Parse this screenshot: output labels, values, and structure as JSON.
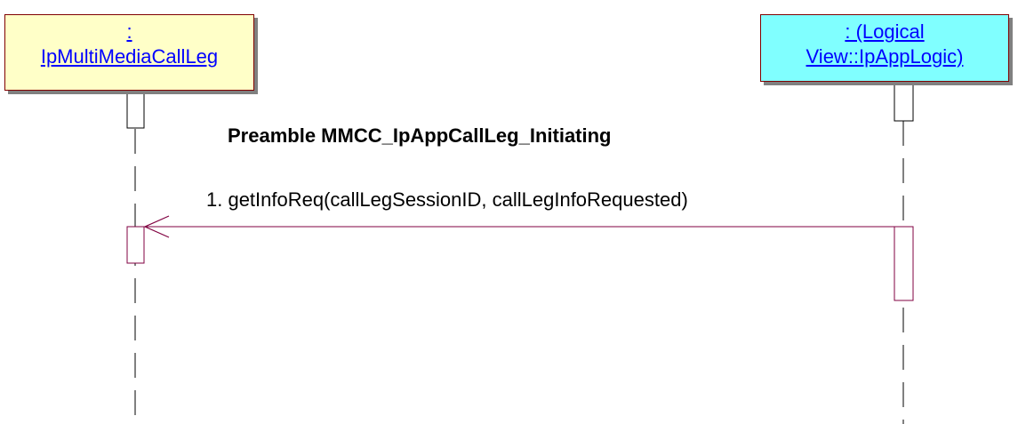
{
  "lifelines": [
    {
      "id": "left",
      "line1": ":",
      "line2": "IpMultiMediaCallLeg"
    },
    {
      "id": "right",
      "line1": ": (Logical",
      "line2": "View::IpAppLogic)"
    }
  ],
  "preamble": "Preamble MMCC_IpAppCallLeg_Initiating",
  "messages": [
    {
      "label": "1. getInfoReq(callLegSessionID, callLegInfoRequested)",
      "from": "right",
      "to": "left"
    }
  ],
  "colors": {
    "box_border": "#800000",
    "left_box_fill": "#ffffc8",
    "right_box_fill": "#80ffff",
    "lifeline_text": "#0000ff",
    "message_line": "#800040",
    "activation_border": "#800040",
    "lifeline_dash": "#000000"
  }
}
